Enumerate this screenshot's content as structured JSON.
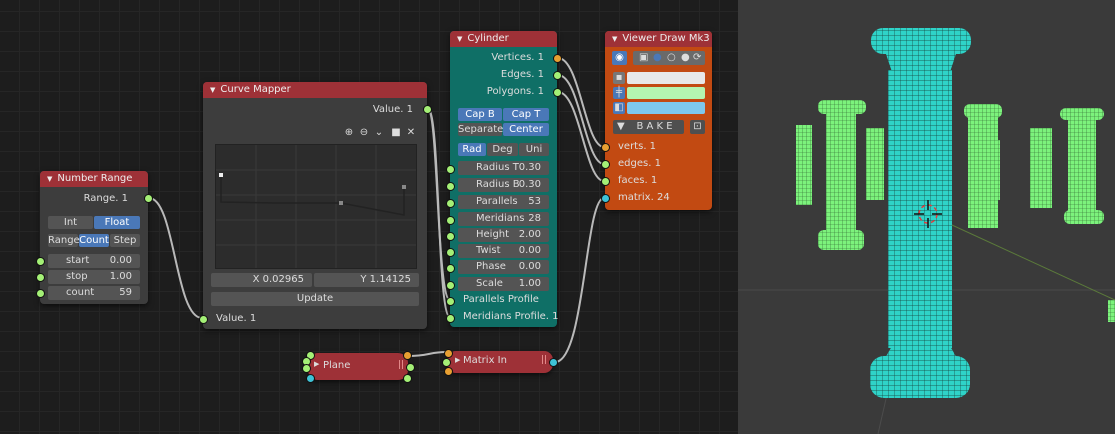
{
  "number_range": {
    "title": "Number Range",
    "output": "Range. 1",
    "mode_tabs": [
      "Int",
      "Float"
    ],
    "range_tabs": [
      "Range",
      "Count",
      "Step"
    ],
    "fields": [
      {
        "label": "start",
        "value": "0.00"
      },
      {
        "label": "stop",
        "value": "1.00"
      },
      {
        "label": "count",
        "value": "59"
      }
    ]
  },
  "curve_mapper": {
    "title": "Curve Mapper",
    "output": "Value. 1",
    "x_readout": "X 0.02965",
    "y_readout": "Y 1.14125",
    "update_label": "Update",
    "input": "Value. 1",
    "tool_icons": [
      "zoom-in-icon",
      "zoom-out-icon",
      "chevron-down-icon",
      "square-icon",
      "close-icon"
    ]
  },
  "cylinder": {
    "title": "Cylinder",
    "outputs": [
      "Vertices. 1",
      "Edges. 1",
      "Polygons. 1"
    ],
    "cap_buttons": [
      "Cap B",
      "Cap T"
    ],
    "pos_buttons": [
      "Separate",
      "Center"
    ],
    "angle_buttons": [
      "Rad",
      "Deg",
      "Uni"
    ],
    "fields": [
      {
        "label": "Radius T",
        "value": "0.30"
      },
      {
        "label": "Radius B",
        "value": "0.30"
      },
      {
        "label": "Parallels",
        "value": "53"
      },
      {
        "label": "Meridians",
        "value": "28"
      },
      {
        "label": "Height",
        "value": "2.00"
      },
      {
        "label": "Twist",
        "value": "0.00"
      },
      {
        "label": "Phase",
        "value": "0.00"
      },
      {
        "label": "Scale",
        "value": "1.00"
      }
    ],
    "inputs": [
      "Parallels Profile",
      "Meridians Profile. 1"
    ]
  },
  "viewer": {
    "title": "Viewer Draw Mk3",
    "bake_label": "B A K E",
    "inputs": [
      "verts. 1",
      "edges. 1",
      "faces. 1",
      "matrix. 24"
    ],
    "colors": {
      "verts": "#e8e8e8",
      "edges": "#b4f5b0",
      "faces": "#7ec8ec"
    }
  },
  "plane": {
    "title": "Plane"
  },
  "matrix_in": {
    "title": "Matrix In"
  },
  "colors": {
    "node_header_red": "#9e3137",
    "cylinder_body": "#0f6f66",
    "viewer_body": "#c24a12",
    "socket_green": "#a4f076",
    "socket_orange": "#e8a032",
    "socket_cyan": "#3fc2d6",
    "mesh_fill": "#2fd3c8",
    "mesh_wire": "#7cf27c"
  }
}
